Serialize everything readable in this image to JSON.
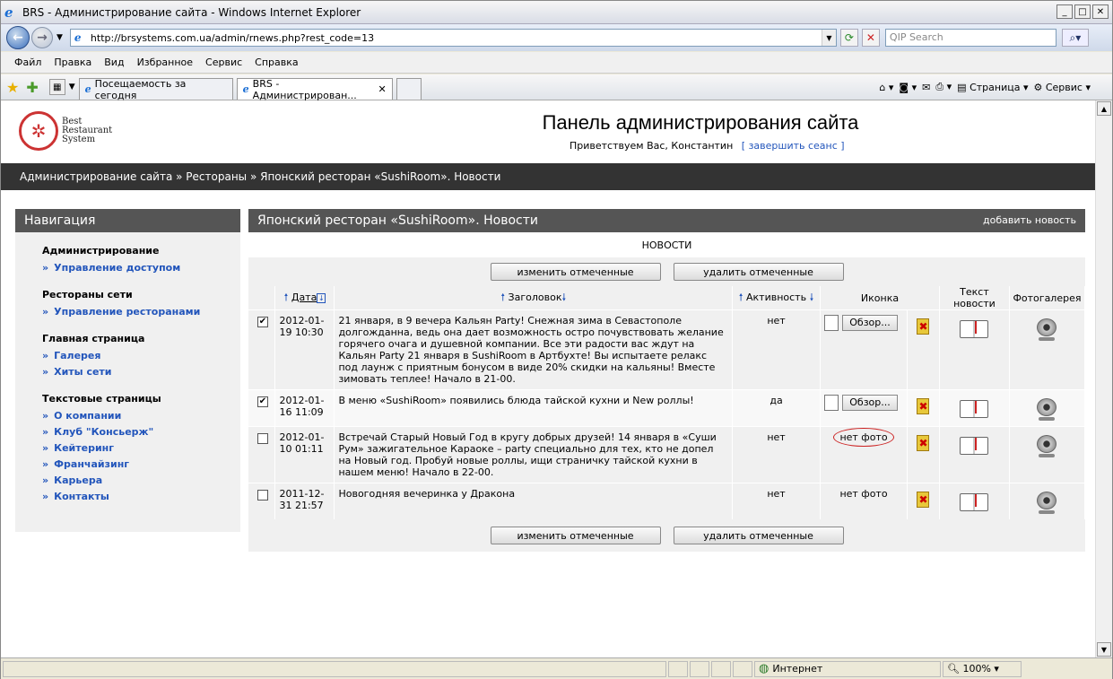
{
  "window": {
    "title": "BRS - Администрирование сайта - Windows Internet Explorer"
  },
  "address": {
    "url": "http://brsystems.com.ua/admin/rnews.php?rest_code=13",
    "search_placeholder": "QIP Search"
  },
  "menu": [
    "Файл",
    "Правка",
    "Вид",
    "Избранное",
    "Сервис",
    "Справка"
  ],
  "tabs": [
    {
      "label": "Посещаемость за сегодня"
    },
    {
      "label": "BRS - Администрирован..."
    }
  ],
  "commandbar": {
    "page": "Страница",
    "tools": "Сервис"
  },
  "status": {
    "zone": "Интернет",
    "zoom": "100%"
  },
  "page": {
    "logo": {
      "line1": "Best",
      "line2": "Restaurant",
      "line3": "System"
    },
    "title": "Панель администрирования сайта",
    "greeting": "Приветствуем Вас, Константин",
    "logout": "[ завершить сеанс ]",
    "breadcrumb": "Администрирование сайта » Рестораны » Японский ресторан «SushiRoom». Новости",
    "nav": {
      "title": "Навигация",
      "groups": [
        {
          "title": "Администрирование",
          "items": [
            "Управление доступом"
          ]
        },
        {
          "title": "Рестораны сети",
          "items": [
            "Управление ресторанами"
          ]
        },
        {
          "title": "Главная страница",
          "items": [
            "Галерея",
            "Хиты сети"
          ]
        },
        {
          "title": "Текстовые страницы",
          "items": [
            "О компании",
            "Клуб \"Консьерж\"",
            "Кейтеринг",
            "Франчайзинг",
            "Карьера",
            "Контакты"
          ]
        }
      ]
    },
    "main": {
      "title": "Японский ресторан «SushiRoom». Новости",
      "add": "добавить новость",
      "subtitle": "НОВОСТИ",
      "edit_btn": "изменить отмеченные",
      "delete_btn": "удалить отмеченные",
      "columns": {
        "date": "Дата",
        "heading": "Заголовок",
        "active": "Активность",
        "icon": "Иконка",
        "text": "Текст новости",
        "gallery": "Фотогалерея"
      },
      "browse": "Обзор...",
      "rows": [
        {
          "checked": "✔",
          "date": "2012-01-19 10:30",
          "heading": "21 января, в 9 вечера Кальян Party! Снежная зима в Севастополе долгожданна, ведь она дает возможность остро почувствовать желание горячего очага и душевной компании. Все эти радости вас ждут на Кальян Party 21 января в SushiRoom в Артбухте! Вы испытаете релакс под лаунж с приятным бонусом в виде 20% скидки на кальяны! Вместе зимовать теплее! Начало в 21-00.",
          "active": "нет",
          "photo": ""
        },
        {
          "checked": "✔",
          "date": "2012-01-16 11:09",
          "heading": "В меню «SushiRoom» появились блюда тайской кухни и New роллы!",
          "active": "да",
          "photo": ""
        },
        {
          "checked": "",
          "date": "2012-01-10 01:11",
          "heading": "Встречай Старый Новый Год в кругу добрых друзей! 14 января в «Суши Рум» зажигательное Караоке – party специально для тех, кто не допел на Новый год. Пробуй новые роллы, ищи страничку тайской кухни в нашем меню! Начало в 22-00.",
          "active": "нет",
          "photo": "нет фото"
        },
        {
          "checked": "",
          "date": "2011-12-31 21:57",
          "heading": "Новогодняя вечеринка у Дракона",
          "active": "нет",
          "photo": "нет фото"
        }
      ]
    }
  }
}
